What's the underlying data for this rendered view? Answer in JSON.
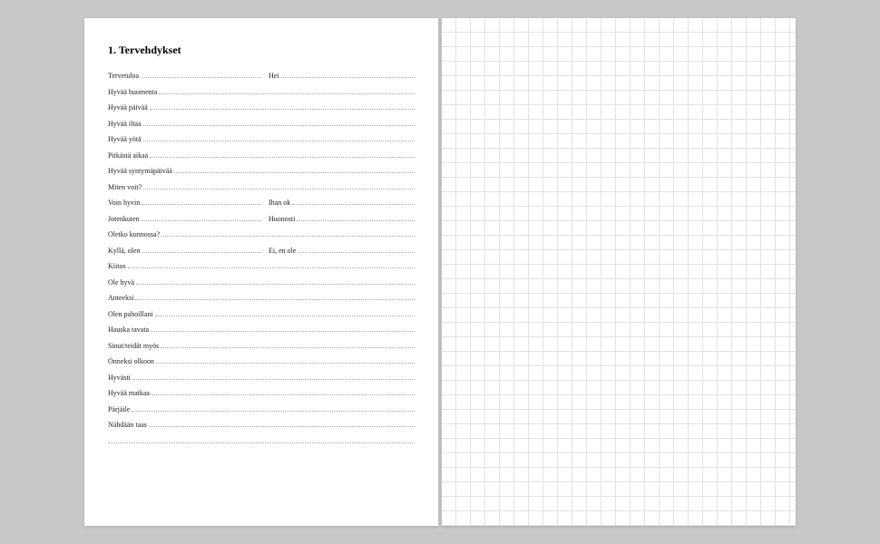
{
  "heading": "1. Tervehdykset",
  "rows": [
    {
      "type": "split",
      "a": "Tervetuloa",
      "b": "Hei"
    },
    {
      "type": "single",
      "a": "Hyvää huomenta"
    },
    {
      "type": "single",
      "a": "Hyvää päivää"
    },
    {
      "type": "single",
      "a": "Hyvää iltaa"
    },
    {
      "type": "single",
      "a": "Hyvää yötä"
    },
    {
      "type": "single",
      "a": "Pitkästä aikaa"
    },
    {
      "type": "single",
      "a": "Hyvää syntymäpäivää"
    },
    {
      "type": "single",
      "a": "Miten voit?"
    },
    {
      "type": "split",
      "a": "Voin hyvin",
      "b": "Ihan ok"
    },
    {
      "type": "split",
      "a": "Jotenkuten",
      "b": "Huonosti"
    },
    {
      "type": "single",
      "a": "Oletko kunnossa?"
    },
    {
      "type": "split",
      "a": "Kyllä, olen",
      "b": "Ei, en ole"
    },
    {
      "type": "single",
      "a": "Kiitos"
    },
    {
      "type": "single",
      "a": "Ole hyvä"
    },
    {
      "type": "single",
      "a": "Anteeksi"
    },
    {
      "type": "single",
      "a": "Olen pahoillani"
    },
    {
      "type": "single",
      "a": "Hauska tavata"
    },
    {
      "type": "single",
      "a": "Sinut/teidät myös"
    },
    {
      "type": "single",
      "a": "Onneksi olkoon"
    },
    {
      "type": "single",
      "a": "Hyvästi"
    },
    {
      "type": "single",
      "a": "Hyvää matkaa"
    },
    {
      "type": "single",
      "a": "Pärjäile"
    },
    {
      "type": "single",
      "a": "Nähdään taas"
    }
  ]
}
